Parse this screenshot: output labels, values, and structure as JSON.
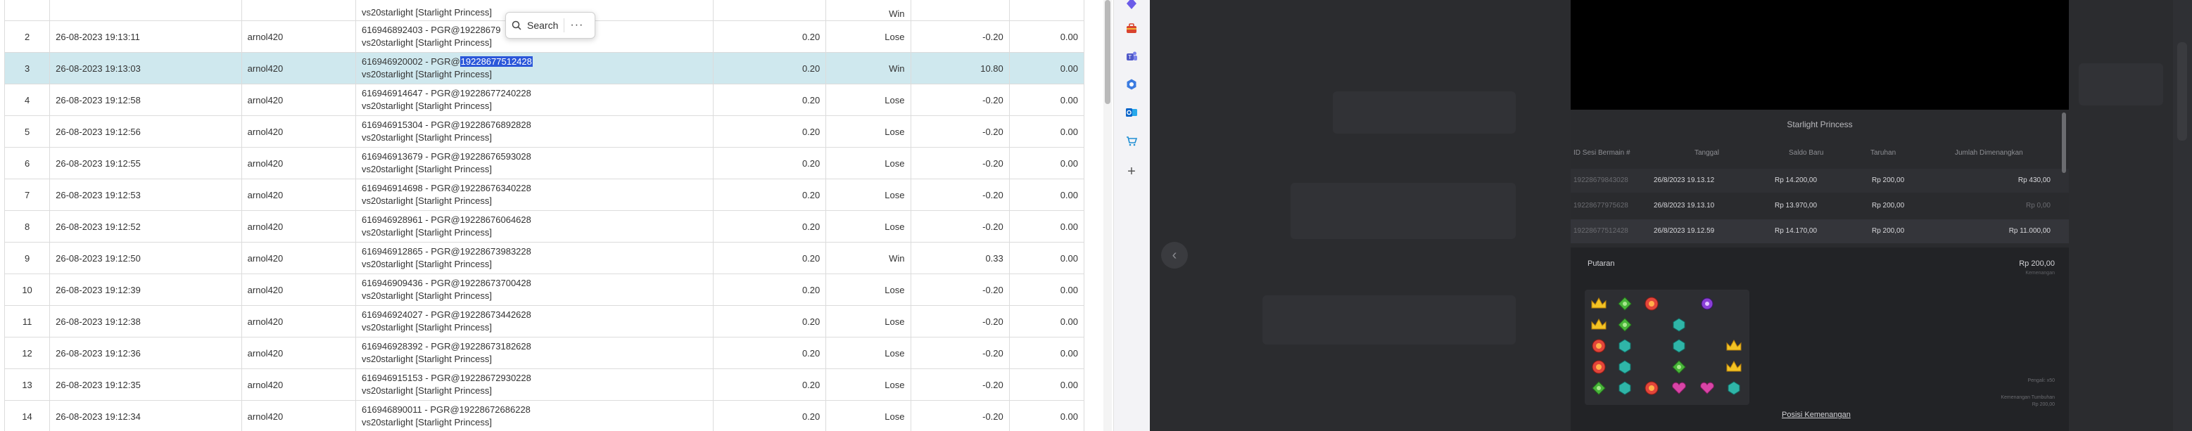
{
  "table": {
    "rows": [
      {
        "no": "2",
        "date": "26-08-2023 19:13:11",
        "user": "arnol420",
        "tx_line1": "616946892403 - PGR@19228679",
        "tx_line2": "vs20starlight [Starlight Princess]",
        "bet": "0.20",
        "result": "Lose",
        "amount": "-0.20",
        "last": "0.00",
        "selected": false
      },
      {
        "no": "3",
        "date": "26-08-2023 19:13:03",
        "user": "arnol420",
        "tx_line1_pre": "616946920002 - PGR@",
        "tx_highlight": "19228677512428",
        "tx_line2": "vs20starlight [Starlight Princess]",
        "bet": "0.20",
        "result": "Win",
        "amount": "10.80",
        "last": "0.00",
        "selected": true
      },
      {
        "no": "4",
        "date": "26-08-2023 19:12:58",
        "user": "arnol420",
        "tx_line1": "616946914647 - PGR@19228677240228",
        "tx_line2": "vs20starlight [Starlight Princess]",
        "bet": "0.20",
        "result": "Lose",
        "amount": "-0.20",
        "last": "0.00",
        "selected": false
      },
      {
        "no": "5",
        "date": "26-08-2023 19:12:56",
        "user": "arnol420",
        "tx_line1": "616946915304 - PGR@19228676892828",
        "tx_line2": "vs20starlight [Starlight Princess]",
        "bet": "0.20",
        "result": "Lose",
        "amount": "-0.20",
        "last": "0.00",
        "selected": false
      },
      {
        "no": "6",
        "date": "26-08-2023 19:12:55",
        "user": "arnol420",
        "tx_line1": "616946913679 - PGR@19228676593028",
        "tx_line2": "vs20starlight [Starlight Princess]",
        "bet": "0.20",
        "result": "Lose",
        "amount": "-0.20",
        "last": "0.00",
        "selected": false
      },
      {
        "no": "7",
        "date": "26-08-2023 19:12:53",
        "user": "arnol420",
        "tx_line1": "616946914698 - PGR@19228676340228",
        "tx_line2": "vs20starlight [Starlight Princess]",
        "bet": "0.20",
        "result": "Lose",
        "amount": "-0.20",
        "last": "0.00",
        "selected": false
      },
      {
        "no": "8",
        "date": "26-08-2023 19:12:52",
        "user": "arnol420",
        "tx_line1": "616946928961 - PGR@19228676064628",
        "tx_line2": "vs20starlight [Starlight Princess]",
        "bet": "0.20",
        "result": "Lose",
        "amount": "-0.20",
        "last": "0.00",
        "selected": false
      },
      {
        "no": "9",
        "date": "26-08-2023 19:12:50",
        "user": "arnol420",
        "tx_line1": "616946912865 - PGR@19228673983228",
        "tx_line2": "vs20starlight [Starlight Princess]",
        "bet": "0.20",
        "result": "Win",
        "amount": "0.33",
        "last": "0.00",
        "selected": false
      },
      {
        "no": "10",
        "date": "26-08-2023 19:12:39",
        "user": "arnol420",
        "tx_line1": "616946909436 - PGR@19228673700428",
        "tx_line2": "vs20starlight [Starlight Princess]",
        "bet": "0.20",
        "result": "Lose",
        "amount": "-0.20",
        "last": "0.00",
        "selected": false
      },
      {
        "no": "11",
        "date": "26-08-2023 19:12:38",
        "user": "arnol420",
        "tx_line1": "616946924027 - PGR@19228673442628",
        "tx_line2": "vs20starlight [Starlight Princess]",
        "bet": "0.20",
        "result": "Lose",
        "amount": "-0.20",
        "last": "0.00",
        "selected": false
      },
      {
        "no": "12",
        "date": "26-08-2023 19:12:36",
        "user": "arnol420",
        "tx_line1": "616946928392 - PGR@19228673182628",
        "tx_line2": "vs20starlight [Starlight Princess]",
        "bet": "0.20",
        "result": "Lose",
        "amount": "-0.20",
        "last": "0.00",
        "selected": false
      },
      {
        "no": "13",
        "date": "26-08-2023 19:12:35",
        "user": "arnol420",
        "tx_line1": "616946915153 - PGR@19228672930228",
        "tx_line2": "vs20starlight [Starlight Princess]",
        "bet": "0.20",
        "result": "Lose",
        "amount": "-0.20",
        "last": "0.00",
        "selected": false
      },
      {
        "no": "14",
        "date": "26-08-2023 19:12:34",
        "user": "arnol420",
        "tx_line1": "616946890011 - PGR@19228672686228",
        "tx_line2": "vs20starlight [Starlight Princess]",
        "bet": "0.20",
        "result": "Lose",
        "amount": "-0.20",
        "last": "0.00",
        "selected": false
      }
    ],
    "top_partial": {
      "tx_line2": "vs20starlight [Starlight Princess]",
      "result": "Win"
    }
  },
  "search_popup": {
    "label": "Search",
    "more": "···"
  },
  "dock": {
    "icons": [
      "copilot-icon",
      "toolbox-icon",
      "teams-icon",
      "settings-hex-icon",
      "outlook-icon",
      "shopping-icon",
      "add-icon"
    ]
  },
  "game": {
    "title": "Starlight Princess",
    "headers": [
      "ID Sesi Bermain #",
      "Tanggal",
      "Saldo Baru",
      "Taruhan",
      "Jumlah Dimenangkan"
    ],
    "rows": [
      {
        "id": "19228679843028",
        "date": "26/8/2023 19.13.12",
        "saldo": "Rp 14.200,00",
        "bet": "Rp 200,00",
        "win": "Rp 430,00",
        "dim": false
      },
      {
        "id": "19228677975628",
        "date": "26/8/2023 19.13.10",
        "saldo": "Rp 13.970,00",
        "bet": "Rp 200,00",
        "win": "Rp 0,00",
        "dim": true
      },
      {
        "id": "19228677512428",
        "date": "26/8/2023 19.12.59",
        "saldo": "Rp 14.170,00",
        "bet": "Rp 200,00",
        "win": "Rp 11.000,00",
        "dim": false
      }
    ],
    "spin_label": "Putaran",
    "spin_bet": "Rp 200,00",
    "spin_bet_sub": "Kemenangan",
    "spin_note_1": "Pengali: x50",
    "spin_note_2": "Kemenangan Tumbuhan",
    "spin_note_3": "Rp 200,00",
    "win_link": "Posisi Kemenangan"
  },
  "colors": {
    "lose": "#e53935",
    "win": "#2e9b36",
    "selected_row": "#cfe8ee",
    "highlight": "#2b57d9"
  }
}
